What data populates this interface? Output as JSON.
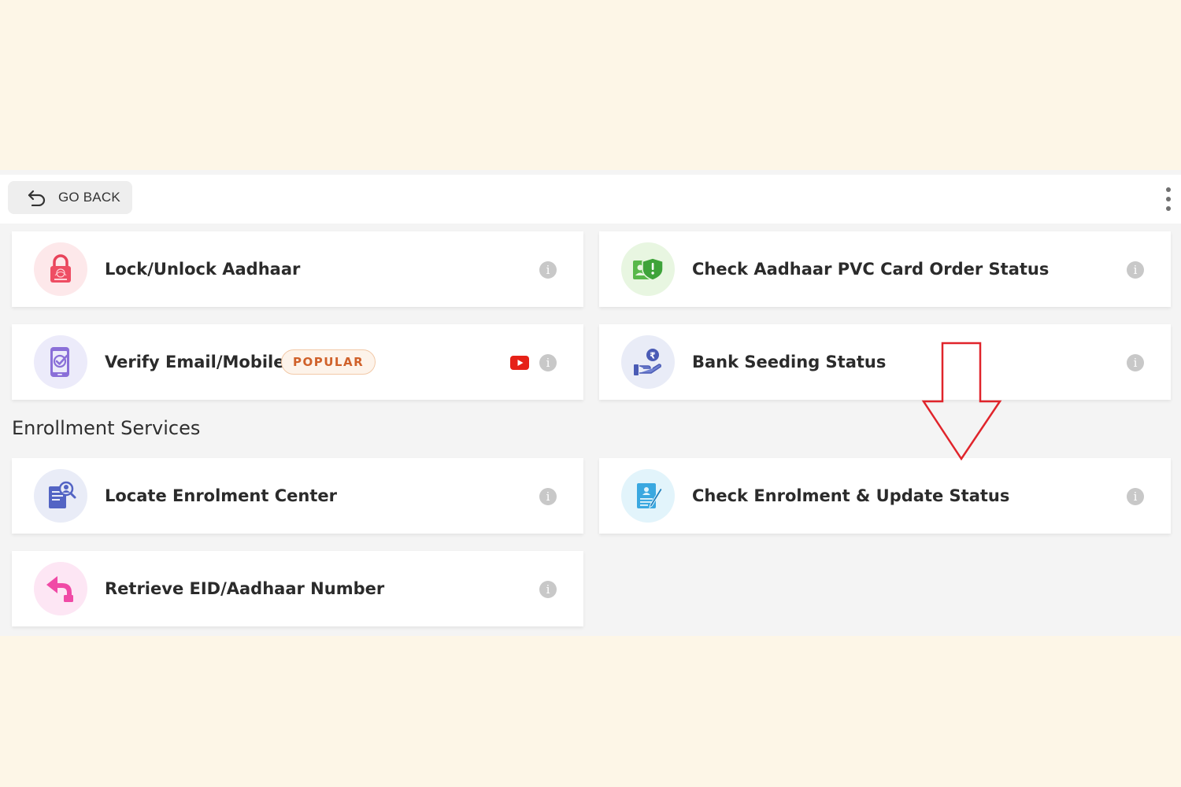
{
  "toolbar": {
    "go_back_label": "GO BACK",
    "back_icon": "undo-arrow-icon",
    "menu_icon": "kebab-menu-icon"
  },
  "services": [
    {
      "title": "Lock/Unlock Aadhaar",
      "icon": "lock-icon"
    },
    {
      "title": "Check Aadhaar PVC Card Order Status",
      "icon": "id-card-shield-icon"
    },
    {
      "title": "Verify Email/Mobile",
      "icon": "phone-check-icon",
      "badge": "POPULAR",
      "has_video": true
    },
    {
      "title": "Bank Seeding Status",
      "icon": "hand-rupee-icon"
    }
  ],
  "enrollment": {
    "heading": "Enrollment Services",
    "items": [
      {
        "title": "Locate Enrolment Center",
        "icon": "document-search-icon"
      },
      {
        "title": "Check Enrolment & Update Status",
        "icon": "form-pen-icon"
      },
      {
        "title": "Retrieve EID/Aadhaar Number",
        "icon": "return-arrow-icon"
      }
    ]
  },
  "colors": {
    "background": "#fdf6e7",
    "panel": "#f4f4f4",
    "badge_text": "#d0612a",
    "annotation_arrow": "#e0242b",
    "youtube": "#e62117"
  }
}
